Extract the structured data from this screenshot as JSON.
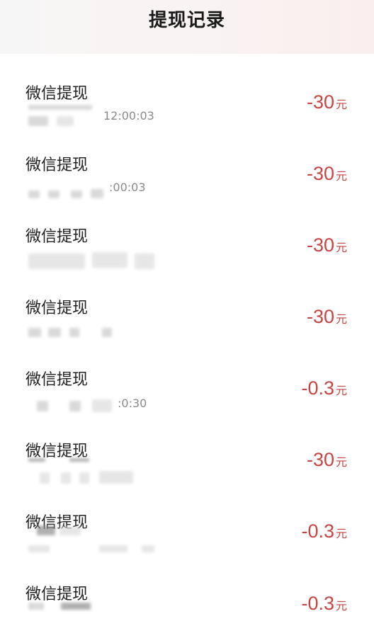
{
  "header": {
    "title": "提现记录"
  },
  "records": [
    {
      "title": "微信提现",
      "time": "12:00:03",
      "amount": "-30",
      "unit": "元"
    },
    {
      "title": "微信提现",
      "time": ":00:03",
      "amount": "-30",
      "unit": "元"
    },
    {
      "title": "微信提现",
      "time": "",
      "amount": "-30",
      "unit": "元"
    },
    {
      "title": "微信提现",
      "time": "",
      "amount": "-30",
      "unit": "元"
    },
    {
      "title": "微信提现",
      "time": ":0:30",
      "amount": "-0.3",
      "unit": "元"
    },
    {
      "title": "微信提现",
      "time": "",
      "amount": "-30",
      "unit": "元"
    },
    {
      "title": "微信提现",
      "time": "",
      "amount": "-0.3",
      "unit": "元"
    },
    {
      "title": "微信提现",
      "time": "",
      "amount": "-0.3",
      "unit": "元"
    }
  ]
}
